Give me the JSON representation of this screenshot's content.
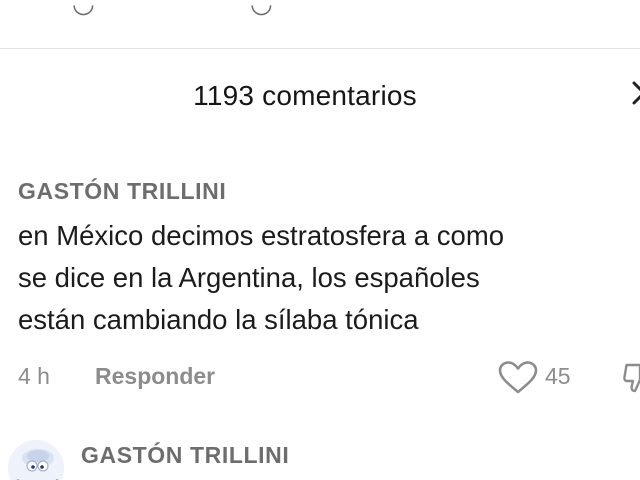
{
  "header": {
    "title": "1193 comentarios"
  },
  "icons": {
    "close": "close-icon",
    "like": "heart-outline-icon",
    "dislike": "thumbs-down-icon"
  },
  "colors": {
    "username": "#6d6d6d",
    "body_text": "#1b1b1b",
    "meta_text": "#8c8c8c"
  },
  "comments": [
    {
      "username": "GASTÓN TRILLINI",
      "text": "en México decimos estratosfera a como\nse dice en la Argentina, los españoles\nestán cambiando la sílaba tónica",
      "timestamp": "4 h",
      "reply_label": "Responder",
      "likes": "45"
    },
    {
      "username": "GASTÓN TRILLINI"
    }
  ]
}
